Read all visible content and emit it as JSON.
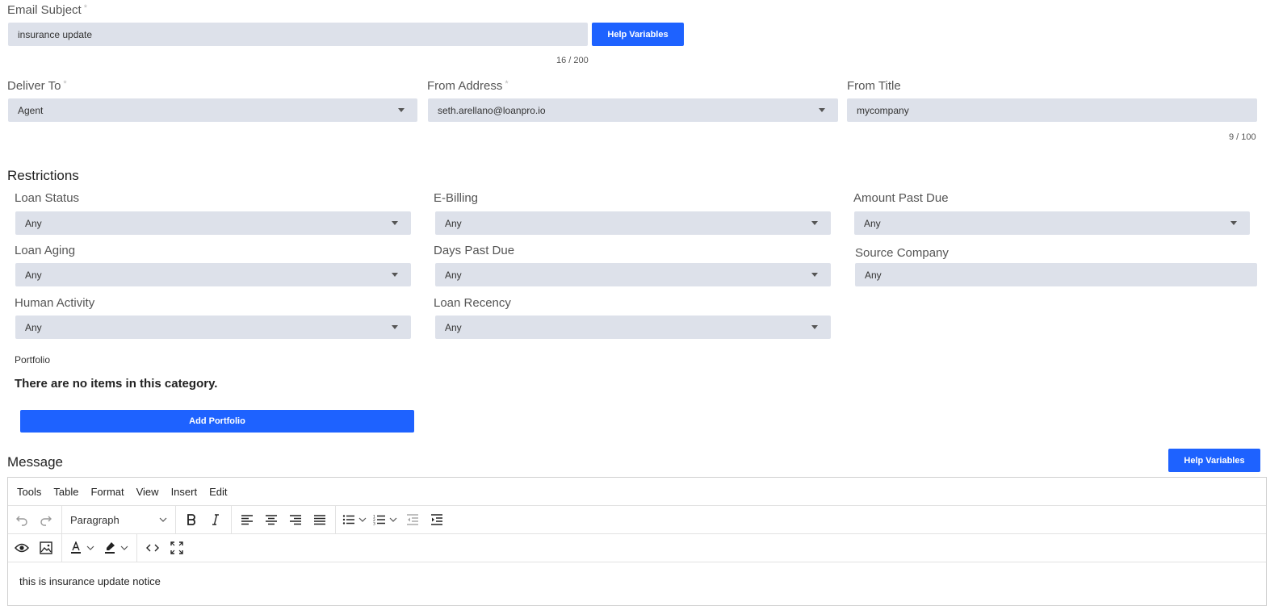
{
  "email_subject": {
    "label": "Email Subject",
    "required_mark": "*",
    "value": "insurance update",
    "counter": "16 / 200",
    "help_button": "Help Variables"
  },
  "deliver_to": {
    "label": "Deliver To",
    "required_mark": "*",
    "value": "Agent"
  },
  "from_address": {
    "label": "From Address",
    "required_mark": "*",
    "value": "seth.arellano@loanpro.io"
  },
  "from_title": {
    "label": "From Title",
    "value": "mycompany",
    "counter": "9 / 100"
  },
  "restrictions": {
    "title": "Restrictions",
    "loan_status": {
      "label": "Loan Status",
      "value": "Any"
    },
    "e_billing": {
      "label": "E-Billing",
      "value": "Any"
    },
    "amount_past_due": {
      "label": "Amount Past Due",
      "value": "Any"
    },
    "loan_aging": {
      "label": "Loan Aging",
      "value": "Any"
    },
    "days_past_due": {
      "label": "Days Past Due",
      "value": "Any"
    },
    "source_company": {
      "label": "Source Company",
      "value": "Any"
    },
    "human_activity": {
      "label": "Human Activity",
      "value": "Any"
    },
    "loan_recency": {
      "label": "Loan Recency",
      "value": "Any"
    }
  },
  "portfolio": {
    "label": "Portfolio",
    "empty_text": "There are no items in this category.",
    "add_button": "Add Portfolio"
  },
  "message": {
    "title": "Message",
    "help_button": "Help Variables",
    "menu": [
      "Tools",
      "Table",
      "Format",
      "View",
      "Insert",
      "Edit"
    ],
    "block_format": "Paragraph",
    "content": "this is insurance update notice"
  },
  "colors": {
    "accent": "#1e62ff",
    "field_bg": "#dde1ea"
  }
}
